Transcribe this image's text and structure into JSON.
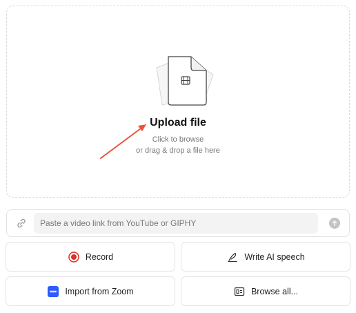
{
  "upload": {
    "title": "Upload file",
    "line1": "Click to browse",
    "line2": "or drag & drop a file here",
    "file_icon": "video-file-icon"
  },
  "link_bar": {
    "placeholder": "Paste a video link from YouTube or GIPHY",
    "value": "",
    "link_icon": "link-icon",
    "submit_icon": "arrow-up-icon"
  },
  "actions": [
    {
      "label": "Record",
      "icon": "record-icon"
    },
    {
      "label": "Write AI speech",
      "icon": "pen-icon"
    },
    {
      "label": "Import from Zoom",
      "icon": "zoom-icon"
    },
    {
      "label": "Browse all...",
      "icon": "browse-icon"
    }
  ],
  "colors": {
    "record_red": "#e0302a",
    "zoom_blue": "#2d5bff",
    "annotation_arrow": "#e8533a"
  }
}
